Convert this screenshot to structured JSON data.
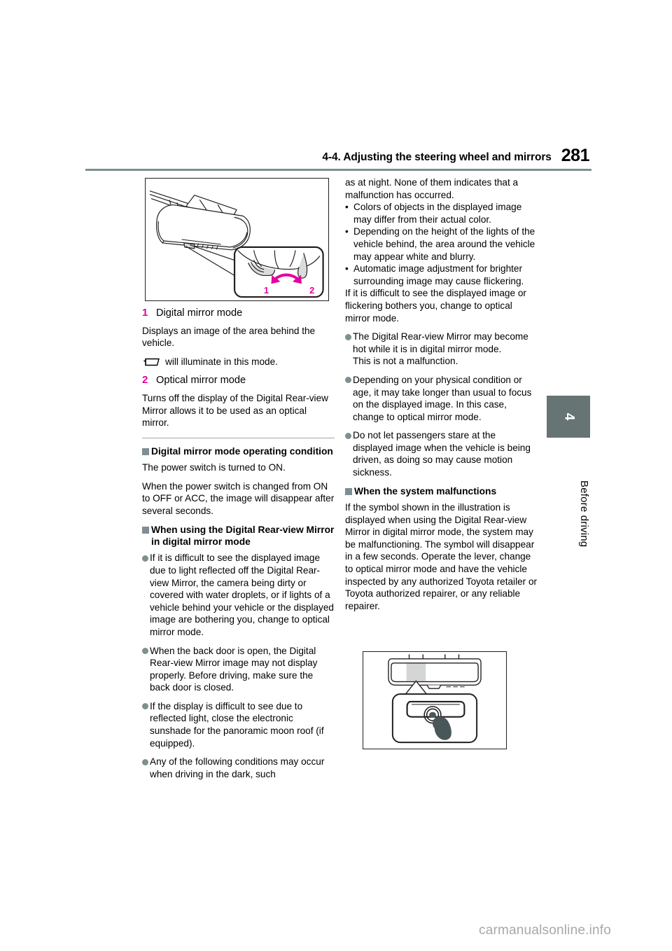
{
  "header": {
    "section_title": "4-4. Adjusting the steering wheel and mirrors",
    "page_number": "281"
  },
  "chapter_tab": {
    "number": "4",
    "label": "Before driving"
  },
  "figures": {
    "mirror_lever": {
      "name": "digital-rear-view-mirror-lever-illustration",
      "callout_1": "1",
      "callout_2": "2",
      "accent_color": "#e5009e"
    },
    "malfunction_symbol": {
      "name": "malfunction-symbol-illustration"
    }
  },
  "left_column": {
    "item1_num": "1",
    "item1_label": "Digital mirror mode",
    "item1_body": "Displays an image of the area behind the vehicle.",
    "icon_line_suffix": "will illuminate in this mode.",
    "icon_name": "digital-mirror-indicator-icon",
    "item2_num": "2",
    "item2_label": "Optical mirror mode",
    "item2_body": "Turns off the display of the Digital Rear-view Mirror allows it to be used as an optical mirror.",
    "heading_operating_condition": "Digital mirror mode operating condition",
    "oc_para1": "The power switch is turned to ON.",
    "oc_para2": "When the power switch is changed from ON to OFF or ACC, the image will disappear after several seconds.",
    "heading_when_using": "When using the Digital Rear-view Mirror in digital mirror mode",
    "bullet1": "If it is difficult to see the displayed image due to light reflected off the Digital Rear-view Mirror, the camera being dirty or covered with water droplets, or if lights of a vehicle behind your vehicle or the displayed image are bothering you, change to optical mirror mode.",
    "bullet2": "When the back door is open, the Digital Rear-view Mirror image may not display properly. Before driving, make sure the back door is closed.",
    "bullet3": "If the display is difficult to see due to reflected light, close the electronic sunshade for the panoramic moon roof (if equipped).",
    "bullet4": "Any of the following conditions may occur when driving in the dark, such"
  },
  "right_column": {
    "cont_para": "as at night. None of them indicates that a malfunction has occurred.",
    "sub_bullet_marker": "•",
    "sub_bullet1": "Colors of objects in the displayed image may differ from their actual color.",
    "sub_bullet2": "Depending on the height of the lights of the vehicle behind, the area around the vehicle may appear white and blurry.",
    "sub_bullet3": "Automatic image adjustment for brighter surrounding image may cause flickering.",
    "after_sub_para": "If it is difficult to see the displayed image or flickering bothers you, change to optical mirror mode.",
    "bullet1": "The Digital Rear-view Mirror may become hot while it is in digital mirror mode.",
    "bullet1_line2": "This is not a malfunction.",
    "bullet2": "Depending on your physical condition or age, it may take longer than usual to focus on the displayed image. In this case, change to optical mirror mode.",
    "bullet3": "Do not let passengers stare at the displayed image when the vehicle is being driven, as doing so may cause motion sickness.",
    "heading_malfunctions": "When the system malfunctions",
    "malfunction_para": "If the symbol shown in the illustration is displayed when using the Digital Rear-view Mirror in digital mirror mode, the system may be malfunctioning. The symbol will disappear in a few seconds. Operate the lever, change to optical mirror mode and have the vehicle inspected by any authorized Toyota retailer or Toyota authorized repairer, or any reliable repairer."
  },
  "footer": {
    "watermark": "carmanualsonline.info"
  }
}
